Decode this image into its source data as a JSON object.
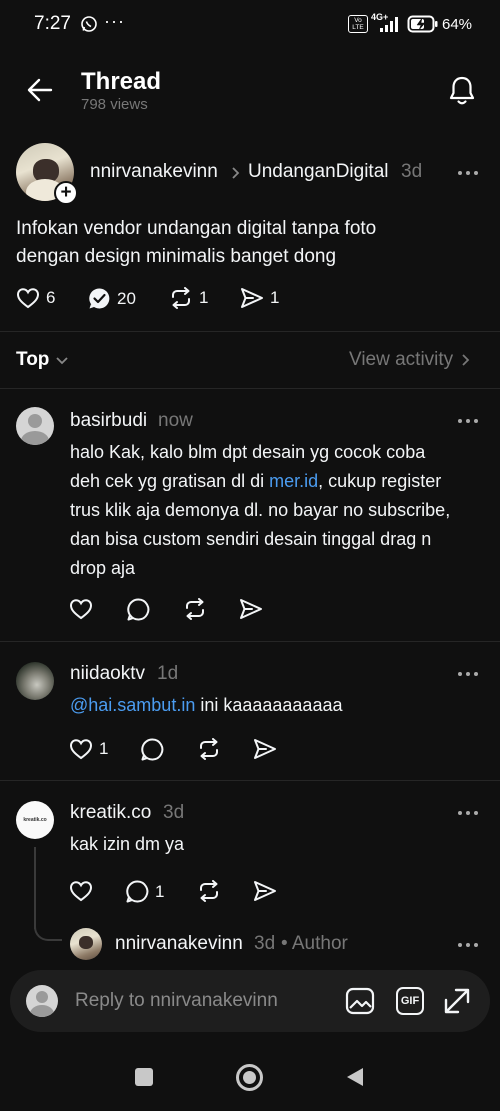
{
  "status_bar": {
    "time": "7:27",
    "battery": "64%",
    "network": "4G+",
    "volte": "Vo LTE"
  },
  "header": {
    "title": "Thread",
    "views": "798 views"
  },
  "post": {
    "username": "nnirvanakevinn",
    "separator": ">",
    "community": "UndanganDigital",
    "time": "3d",
    "text_line1": "Infokan vendor undangan digital tanpa foto",
    "text_line2": "dengan design minimalis banget dong",
    "likes": "6",
    "replies": "20",
    "reposts": "1",
    "shares": "1"
  },
  "sort": {
    "label": "Top",
    "view_activity": "View activity"
  },
  "comments": [
    {
      "username": "basirbudi",
      "time": "now",
      "lines": [
        "halo Kak, kalo blm dpt desain yg cocok coba",
        "deh cek yg gratisan dl di ",
        "mer.id",
        ", cukup register",
        "trus klik aja demonya dl. no bayar no subscribe,",
        "dan bisa custom sendiri desain tinggal drag n",
        "drop aja"
      ]
    },
    {
      "username": "niidaoktv",
      "time": "1d",
      "mention": "@hai.sambut.in",
      "text": " ini kaaaaaaaaaaa",
      "likes": "1"
    },
    {
      "username": "kreatik.co",
      "time": "3d",
      "text": "kak izin dm ya",
      "replies": "1",
      "avatar_text": "kreatik.co"
    },
    {
      "username": "nnirvanakevinn",
      "time": "3d",
      "badge": "• Author"
    }
  ],
  "reply_bar": {
    "placeholder": "Reply to nnirvanakevinn",
    "gif": "GIF"
  },
  "icons": {
    "back": "arrow-left-icon",
    "bell": "bell-icon",
    "more": "more-dots-icon",
    "heart": "heart-icon",
    "reply": "reply-bubble-icon",
    "repost": "repost-icon",
    "share": "send-icon"
  }
}
